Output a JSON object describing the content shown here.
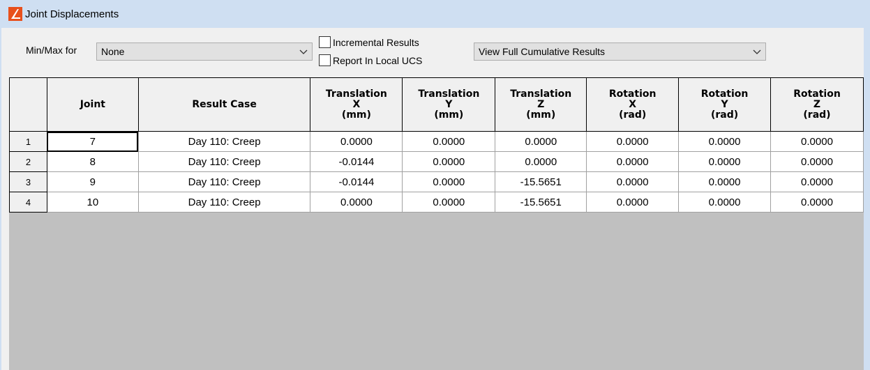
{
  "window": {
    "title": "Joint Displacements"
  },
  "toolbar": {
    "minmax_label": "Min/Max for",
    "minmax_value": "None",
    "incremental_label": "Incremental Results",
    "local_ucs_label": "Report In Local UCS",
    "view_value": "View Full Cumulative Results"
  },
  "table": {
    "headers": [
      {
        "lines": [
          "Joint"
        ]
      },
      {
        "lines": [
          "Result Case"
        ]
      },
      {
        "lines": [
          "Translation",
          "X",
          "(mm)"
        ]
      },
      {
        "lines": [
          "Translation",
          "Y",
          "(mm)"
        ]
      },
      {
        "lines": [
          "Translation",
          "Z",
          "(mm)"
        ]
      },
      {
        "lines": [
          "Rotation",
          "X",
          "(rad)"
        ]
      },
      {
        "lines": [
          "Rotation",
          "Y",
          "(rad)"
        ]
      },
      {
        "lines": [
          "Rotation",
          "Z",
          "(rad)"
        ]
      }
    ],
    "rows": [
      {
        "num": "1",
        "cells": [
          "7",
          "Day 110: Creep",
          "0.0000",
          "0.0000",
          "0.0000",
          "0.0000",
          "0.0000",
          "0.0000"
        ]
      },
      {
        "num": "2",
        "cells": [
          "8",
          "Day 110: Creep",
          "-0.0144",
          "0.0000",
          "0.0000",
          "0.0000",
          "0.0000",
          "0.0000"
        ]
      },
      {
        "num": "3",
        "cells": [
          "9",
          "Day 110: Creep",
          "-0.0144",
          "0.0000",
          "-15.5651",
          "0.0000",
          "0.0000",
          "0.0000"
        ]
      },
      {
        "num": "4",
        "cells": [
          "10",
          "Day 110: Creep",
          "0.0000",
          "0.0000",
          "-15.5651",
          "0.0000",
          "0.0000",
          "0.0000"
        ]
      }
    ]
  }
}
